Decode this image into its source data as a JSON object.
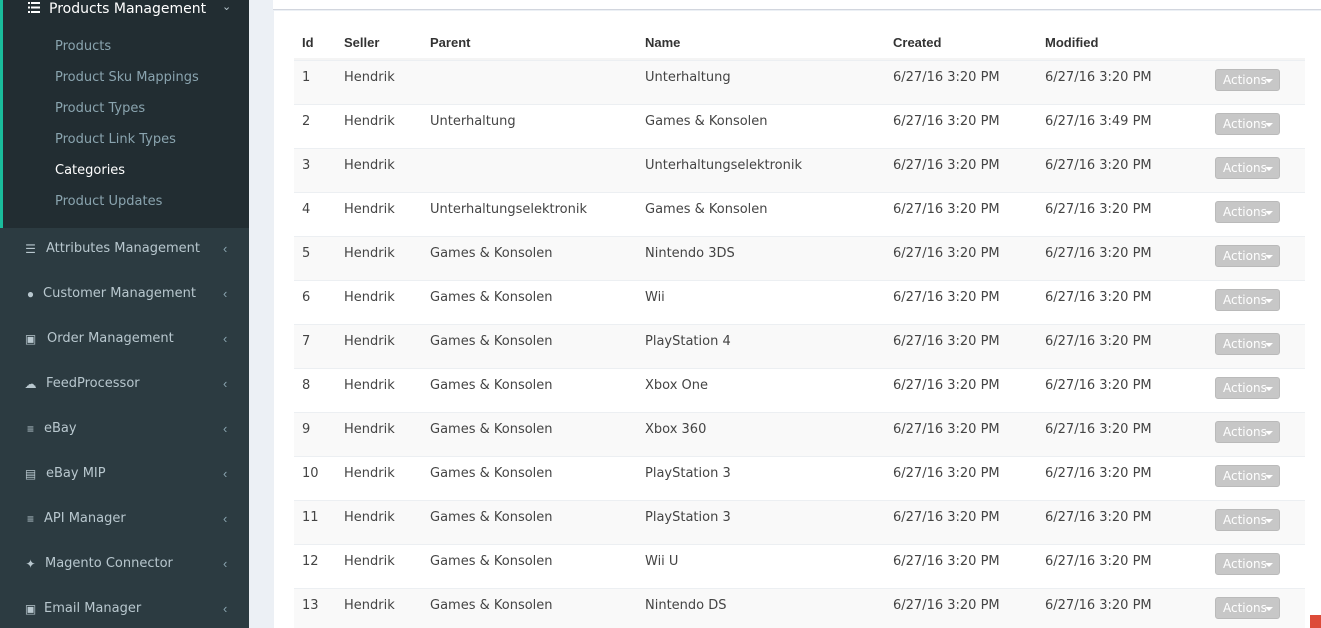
{
  "sidebar": {
    "open_menu": {
      "title": "Products Management",
      "icon": "list-icon",
      "items": [
        {
          "label": "Products"
        },
        {
          "label": "Product Sku Mappings"
        },
        {
          "label": "Product Types"
        },
        {
          "label": "Product Link Types"
        },
        {
          "label": "Categories"
        },
        {
          "label": "Product Updates"
        }
      ]
    },
    "menus": [
      {
        "label": "Attributes Management",
        "icon": "list-ul-icon"
      },
      {
        "label": "Customer Management",
        "icon": "user-icon"
      },
      {
        "label": "Order Management",
        "icon": "basket-icon"
      },
      {
        "label": "FeedProcessor",
        "icon": "cloud-icon"
      },
      {
        "label": "eBay",
        "icon": "cart-icon"
      },
      {
        "label": "eBay MIP",
        "icon": "money-icon"
      },
      {
        "label": "API Manager",
        "icon": "cart-icon"
      },
      {
        "label": "Magento Connector",
        "icon": "plug-icon"
      },
      {
        "label": "Email Manager",
        "icon": "inbox-icon"
      }
    ]
  },
  "table": {
    "columns": {
      "id": "Id",
      "seller": "Seller",
      "parent": "Parent",
      "name": "Name",
      "created": "Created",
      "modified": "Modified"
    },
    "actions_label": "Actions",
    "rows": [
      {
        "id": "1",
        "seller": "Hendrik",
        "parent": "",
        "name": "Unterhaltung",
        "created": "6/27/16 3:20 PM",
        "modified": "6/27/16 3:20 PM"
      },
      {
        "id": "2",
        "seller": "Hendrik",
        "parent": "Unterhaltung",
        "name": "Games & Konsolen",
        "created": "6/27/16 3:20 PM",
        "modified": "6/27/16 3:49 PM"
      },
      {
        "id": "3",
        "seller": "Hendrik",
        "parent": "",
        "name": "Unterhaltungselektronik",
        "created": "6/27/16 3:20 PM",
        "modified": "6/27/16 3:20 PM"
      },
      {
        "id": "4",
        "seller": "Hendrik",
        "parent": "Unterhaltungselektronik",
        "name": "Games & Konsolen",
        "created": "6/27/16 3:20 PM",
        "modified": "6/27/16 3:20 PM"
      },
      {
        "id": "5",
        "seller": "Hendrik",
        "parent": "Games & Konsolen",
        "name": "Nintendo 3DS",
        "created": "6/27/16 3:20 PM",
        "modified": "6/27/16 3:20 PM"
      },
      {
        "id": "6",
        "seller": "Hendrik",
        "parent": "Games & Konsolen",
        "name": "Wii",
        "created": "6/27/16 3:20 PM",
        "modified": "6/27/16 3:20 PM"
      },
      {
        "id": "7",
        "seller": "Hendrik",
        "parent": "Games & Konsolen",
        "name": "PlayStation 4",
        "created": "6/27/16 3:20 PM",
        "modified": "6/27/16 3:20 PM"
      },
      {
        "id": "8",
        "seller": "Hendrik",
        "parent": "Games & Konsolen",
        "name": "Xbox One",
        "created": "6/27/16 3:20 PM",
        "modified": "6/27/16 3:20 PM"
      },
      {
        "id": "9",
        "seller": "Hendrik",
        "parent": "Games & Konsolen",
        "name": "Xbox 360",
        "created": "6/27/16 3:20 PM",
        "modified": "6/27/16 3:20 PM"
      },
      {
        "id": "10",
        "seller": "Hendrik",
        "parent": "Games & Konsolen",
        "name": "PlayStation 3",
        "created": "6/27/16 3:20 PM",
        "modified": "6/27/16 3:20 PM"
      },
      {
        "id": "11",
        "seller": "Hendrik",
        "parent": "Games & Konsolen",
        "name": "PlayStation 3",
        "created": "6/27/16 3:20 PM",
        "modified": "6/27/16 3:20 PM"
      },
      {
        "id": "12",
        "seller": "Hendrik",
        "parent": "Games & Konsolen",
        "name": "Wii U",
        "created": "6/27/16 3:20 PM",
        "modified": "6/27/16 3:20 PM"
      },
      {
        "id": "13",
        "seller": "Hendrik",
        "parent": "Games & Konsolen",
        "name": "Nintendo DS",
        "created": "6/27/16 3:20 PM",
        "modified": "6/27/16 3:20 PM"
      }
    ]
  }
}
